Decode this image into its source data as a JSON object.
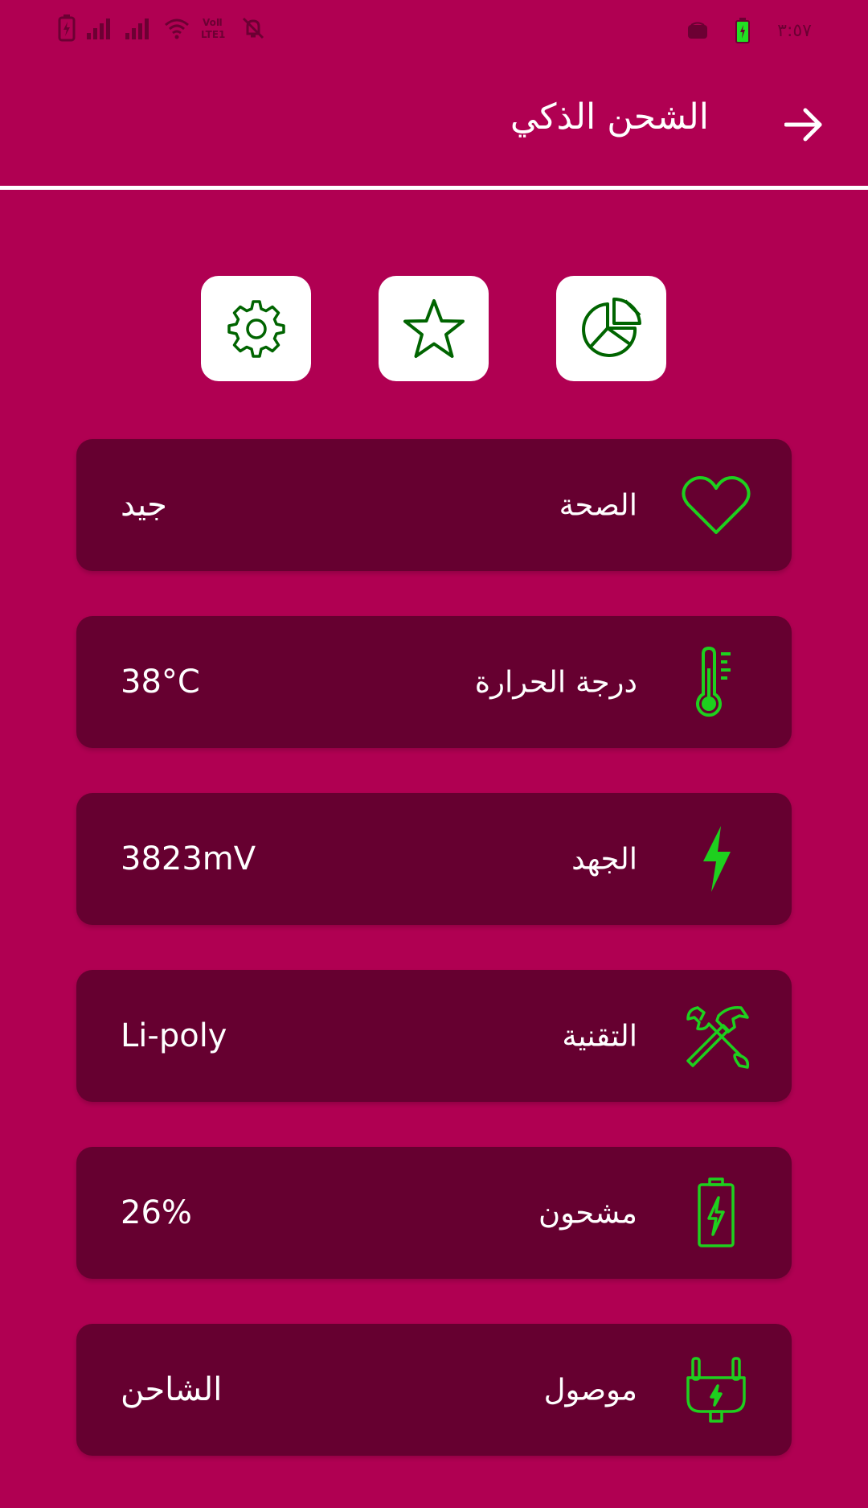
{
  "status_bar": {
    "time": "٣:٥٧",
    "left_icons": [
      "battery-charging-icon",
      "signal-icon",
      "signal-icon",
      "wifi-icon",
      "volte-icon",
      "mute-icon"
    ],
    "right_icons": [
      "notification-icon",
      "battery-icon"
    ]
  },
  "app_bar": {
    "title": "الشحن الذكي",
    "back_icon": "arrow-right-icon"
  },
  "quick_actions": [
    {
      "icon": "settings-icon"
    },
    {
      "icon": "star-icon"
    },
    {
      "icon": "pie-chart-icon"
    }
  ],
  "cards": [
    {
      "label": "الصحة",
      "value": "جيد",
      "icon": "heart-icon"
    },
    {
      "label": "درجة الحرارة",
      "value": "38°C",
      "icon": "thermometer-icon"
    },
    {
      "label": "الجهد",
      "value": "3823mV",
      "icon": "lightning-icon"
    },
    {
      "label": "التقنية",
      "value": "Li-poly",
      "icon": "tools-icon"
    },
    {
      "label": "مشحون",
      "value": "26%",
      "icon": "battery-charging-icon"
    },
    {
      "label": "موصول",
      "value": "الشاحن",
      "icon": "plug-icon"
    }
  ],
  "colors": {
    "background": "#b00052",
    "card": "#660030",
    "icon_green": "#1ed01e",
    "action_icon_green": "#006400",
    "action_button": "#ffffff"
  }
}
